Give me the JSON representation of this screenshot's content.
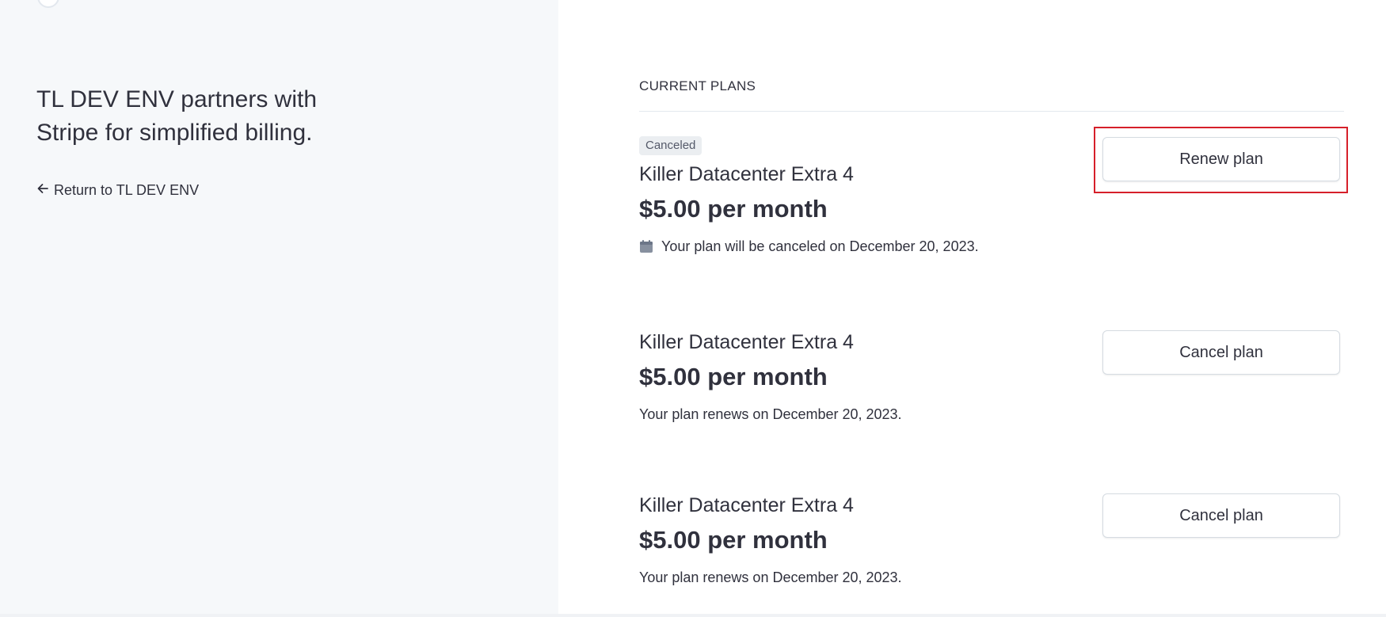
{
  "left": {
    "headline": "TL DEV ENV partners with Stripe for simplified billing.",
    "return_link": "Return to TL DEV ENV"
  },
  "right": {
    "section_title": "CURRENT PLANS",
    "plans": [
      {
        "badge": "Canceled",
        "name": "Killer Datacenter Extra 4",
        "price": "$5.00 per month",
        "note": "Your plan will be canceled on December 20, 2023.",
        "action": "Renew plan"
      },
      {
        "name": "Killer Datacenter Extra 4",
        "price": "$5.00 per month",
        "note": "Your plan renews on December 20, 2023.",
        "action": "Cancel plan"
      },
      {
        "name": "Killer Datacenter Extra 4",
        "price": "$5.00 per month",
        "note": "Your plan renews on December 20, 2023.",
        "action": "Cancel plan"
      }
    ]
  },
  "colors": {
    "left_background": "#f6f8fa",
    "text": "#30313d",
    "badge_background": "#ebeef1",
    "highlight": "#d6202a"
  },
  "icons": [
    "arrow-left-icon",
    "calendar-icon"
  ]
}
